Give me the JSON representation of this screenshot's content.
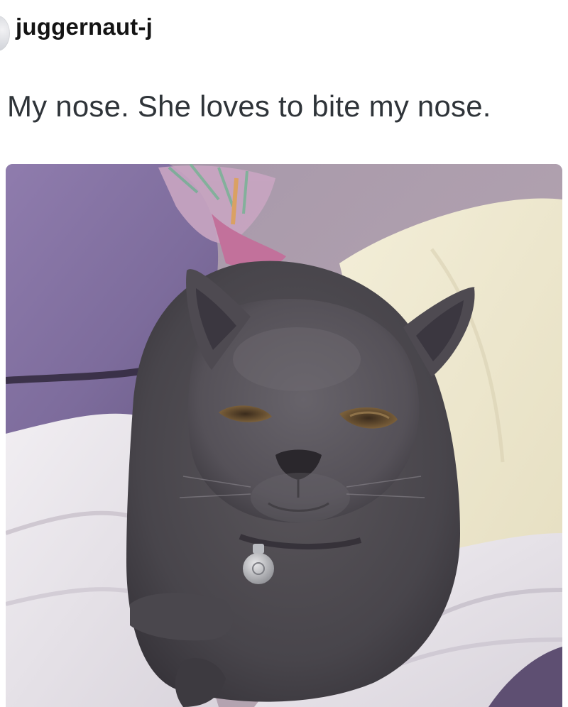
{
  "post": {
    "username": "juggernaut-j",
    "caption": "My nose. She loves to bite my nose.",
    "avatar_icon": "user-avatar-icon"
  },
  "colors": {
    "username_text": "#141414",
    "caption_text": "#2f3439",
    "background": "#ffffff",
    "cat_fur": "#4a474c",
    "pillow_purple": "#8a77a8",
    "blanket_white": "#ece9ec",
    "blanket_cream": "#efead2"
  }
}
